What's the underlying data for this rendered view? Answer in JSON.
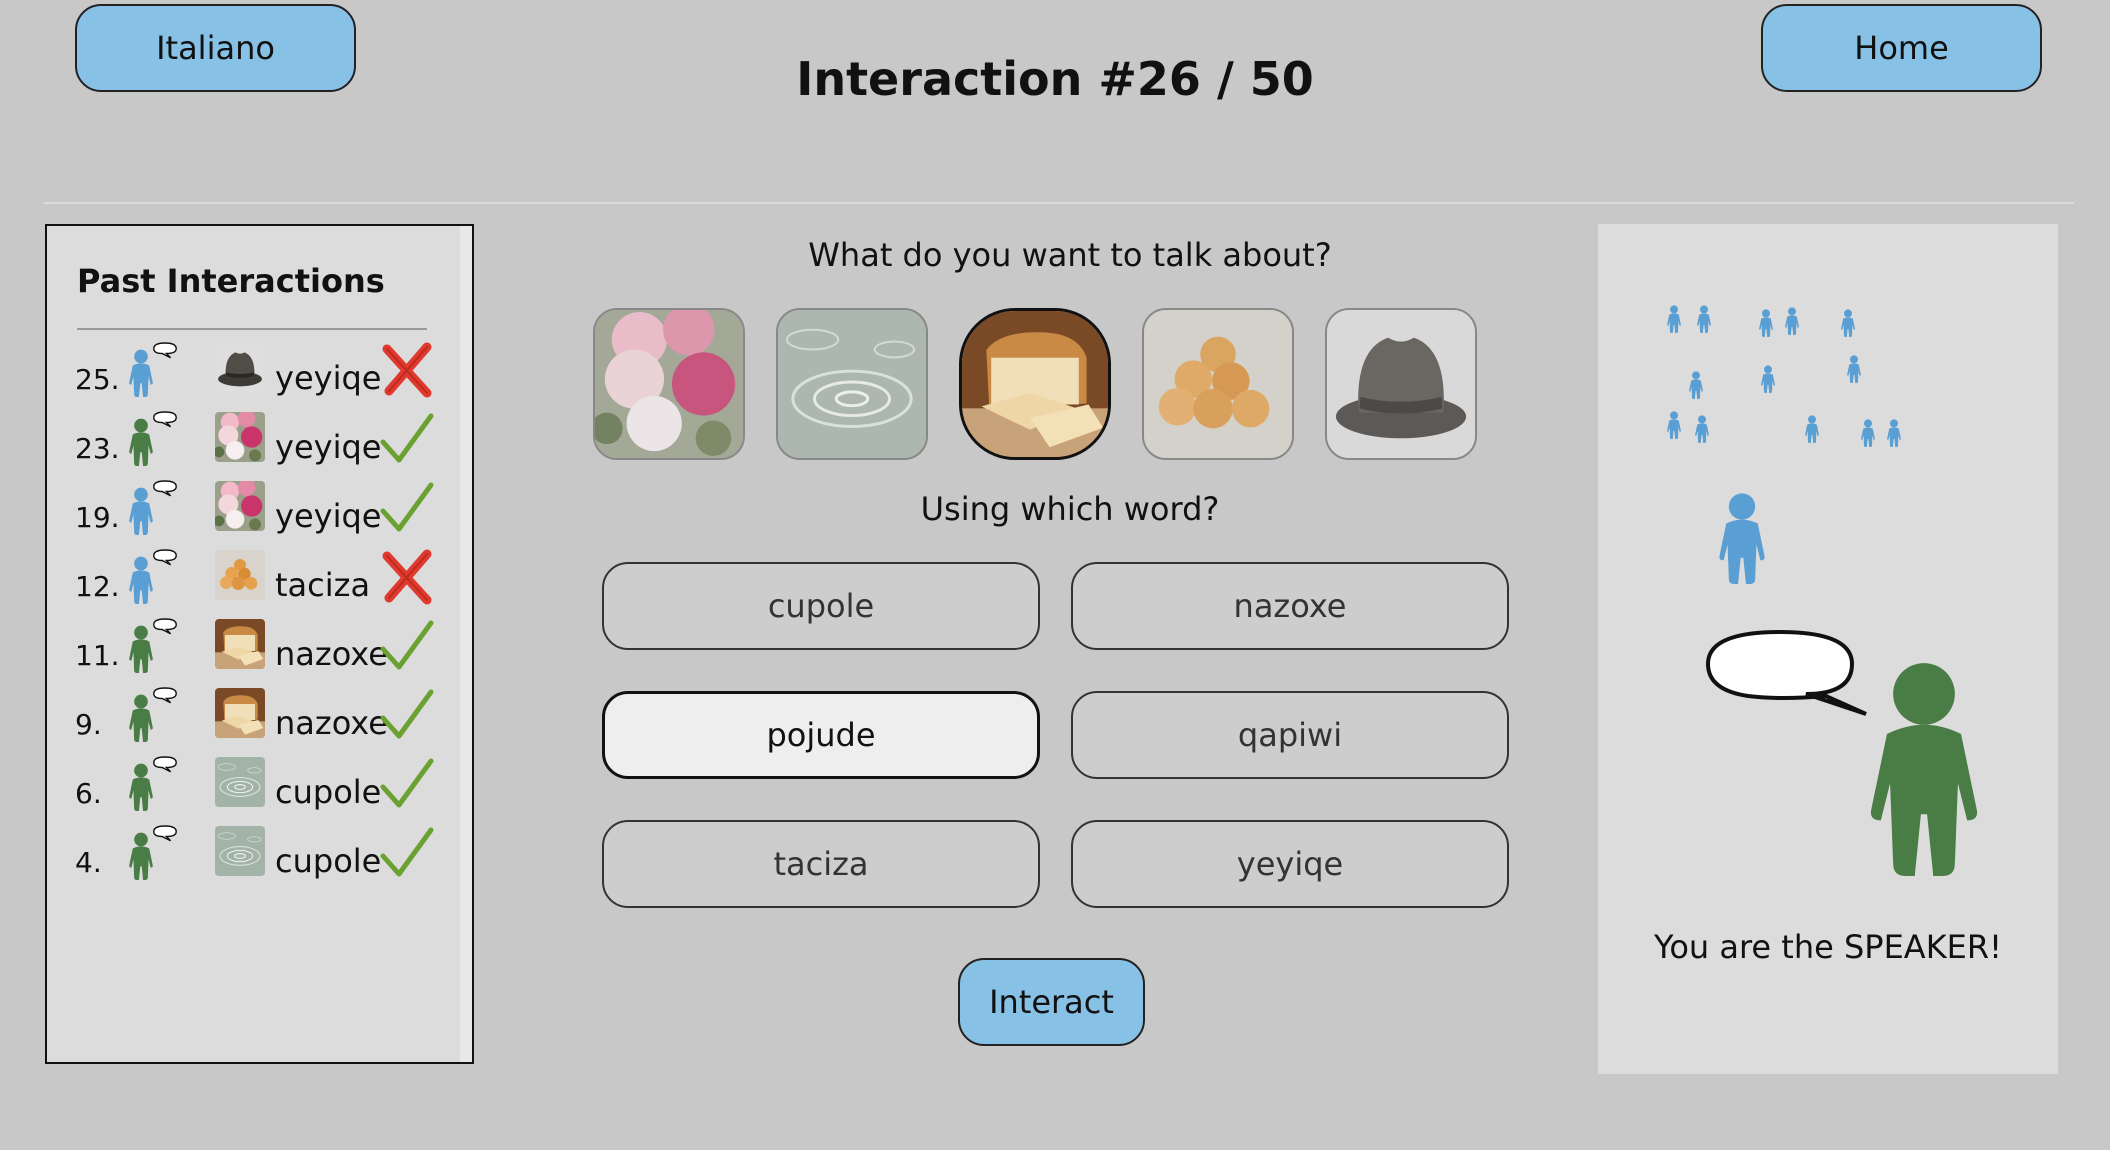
{
  "header": {
    "language_button": "Italiano",
    "home_button": "Home",
    "title": "Interaction #26 / 50"
  },
  "past_interactions": {
    "title": "Past Interactions",
    "rows": [
      {
        "num": "25.",
        "speaker": "blue",
        "image": "hat-icon",
        "word": "yeyiqe",
        "result": "incorrect"
      },
      {
        "num": "23.",
        "speaker": "green",
        "image": "flowers-icon",
        "word": "yeyiqe",
        "result": "correct"
      },
      {
        "num": "19.",
        "speaker": "blue",
        "image": "flowers-icon",
        "word": "yeyiqe",
        "result": "correct"
      },
      {
        "num": "12.",
        "speaker": "blue",
        "image": "apricots-icon",
        "word": "taciza",
        "result": "incorrect"
      },
      {
        "num": "11.",
        "speaker": "green",
        "image": "bread-icon",
        "word": "nazoxe",
        "result": "correct"
      },
      {
        "num": "9.",
        "speaker": "green",
        "image": "bread-icon",
        "word": "nazoxe",
        "result": "correct"
      },
      {
        "num": "6.",
        "speaker": "green",
        "image": "water-icon",
        "word": "cupole",
        "result": "correct"
      },
      {
        "num": "4.",
        "speaker": "green",
        "image": "water-icon",
        "word": "cupole",
        "result": "correct"
      }
    ]
  },
  "main": {
    "topic_question": "What do you want to talk about?",
    "topics": [
      {
        "name": "flowers",
        "selected": false
      },
      {
        "name": "water",
        "selected": false
      },
      {
        "name": "bread",
        "selected": true
      },
      {
        "name": "apricots",
        "selected": false
      },
      {
        "name": "hat",
        "selected": false
      }
    ],
    "word_question": "Using which word?",
    "words": [
      {
        "label": "cupole",
        "selected": false
      },
      {
        "label": "nazoxe",
        "selected": false
      },
      {
        "label": "pojude",
        "selected": true
      },
      {
        "label": "qapiwi",
        "selected": false
      },
      {
        "label": "taciza",
        "selected": false
      },
      {
        "label": "yeyiqe",
        "selected": false
      }
    ],
    "interact_button": "Interact"
  },
  "speaker_panel": {
    "role_text": "You are the SPEAKER!"
  },
  "colors": {
    "background": "#c8c8c8",
    "button_blue": "#87c1e6",
    "agent_blue": "#5a9fd4",
    "agent_green": "#4a7c45",
    "correct_green": "#6aa232",
    "incorrect_red": "#e03a2e"
  }
}
